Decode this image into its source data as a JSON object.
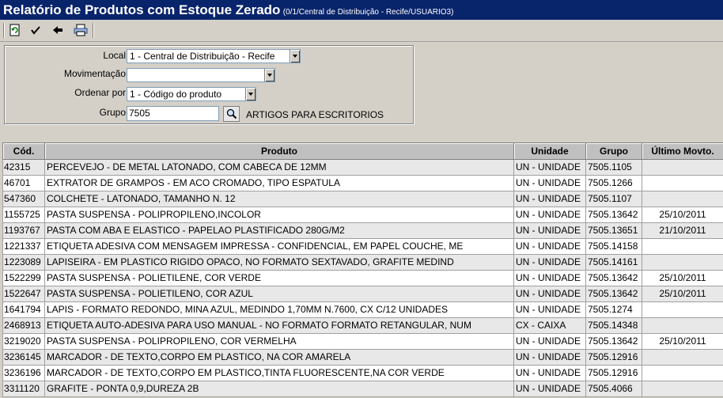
{
  "window": {
    "title": "Relatório de Produtos com Estoque Zerado",
    "subtitle": "(0/1/Central de Distribuição - Recife/USUARIO3)"
  },
  "toolbar": {
    "icons": [
      "refresh-icon",
      "check-icon",
      "back-arrow-icon",
      "printer-icon"
    ]
  },
  "filters": {
    "local_label": "Local",
    "local_value": "1 - Central de Distribuição - Recife",
    "movimentacao_label": "Movimentação",
    "movimentacao_value": "",
    "ordenar_label": "Ordenar por",
    "ordenar_value": "1 - Código do produto",
    "grupo_label": "Grupo",
    "grupo_value": "7505",
    "grupo_desc": "ARTIGOS PARA ESCRITORIOS"
  },
  "table": {
    "headers": [
      "Cód.",
      "Produto",
      "Unidade",
      "Grupo",
      "Último Movto."
    ],
    "rows": [
      [
        "42315",
        "PERCEVEJO - DE METAL LATONADO, COM CABECA DE 12MM",
        "UN - UNIDADE",
        "7505.1105",
        ""
      ],
      [
        "46701",
        "EXTRATOR DE GRAMPOS - EM ACO CROMADO, TIPO ESPATULA",
        "UN - UNIDADE",
        "7505.1266",
        ""
      ],
      [
        "547360",
        "COLCHETE - LATONADO, TAMANHO N. 12",
        "UN - UNIDADE",
        "7505.1107",
        ""
      ],
      [
        "1155725",
        "PASTA SUSPENSA - POLIPROPILENO,INCOLOR",
        "UN - UNIDADE",
        "7505.13642",
        "25/10/2011"
      ],
      [
        "1193767",
        "PASTA COM ABA E ELASTICO - PAPELAO PLASTIFICADO 280G/M2",
        "UN - UNIDADE",
        "7505.13651",
        "21/10/2011"
      ],
      [
        "1221337",
        "ETIQUETA ADESIVA COM MENSAGEM IMPRESSA - CONFIDENCIAL, EM PAPEL COUCHE, ME",
        "UN - UNIDADE",
        "7505.14158",
        ""
      ],
      [
        "1223089",
        "LAPISEIRA - EM PLASTICO RIGIDO OPACO, NO FORMATO SEXTAVADO, GRAFITE MEDIND",
        "UN - UNIDADE",
        "7505.14161",
        ""
      ],
      [
        "1522299",
        "PASTA SUSPENSA - POLIETILENE, COR VERDE",
        "UN - UNIDADE",
        "7505.13642",
        "25/10/2011"
      ],
      [
        "1522647",
        "PASTA SUSPENSA - POLIETILENO, COR AZUL",
        "UN - UNIDADE",
        "7505.13642",
        "25/10/2011"
      ],
      [
        "1641794",
        "LAPIS - FORMATO REDONDO, MINA AZUL, MEDINDO 1,70MM N.7600, CX C/12 UNIDADES",
        "UN - UNIDADE",
        "7505.1274",
        ""
      ],
      [
        "2468913",
        "ETIQUETA AUTO-ADESIVA PARA USO MANUAL - NO FORMATO FORMATO RETANGULAR, NUM",
        "CX - CAIXA",
        "7505.14348",
        ""
      ],
      [
        "3219020",
        "PASTA SUSPENSA - POLIPROPILENO, COR VERMELHA",
        "UN - UNIDADE",
        "7505.13642",
        "25/10/2011"
      ],
      [
        "3236145",
        "MARCADOR - DE TEXTO,CORPO EM PLASTICO, NA COR AMARELA",
        "UN - UNIDADE",
        "7505.12916",
        ""
      ],
      [
        "3236196",
        "MARCADOR - DE TEXTO,CORPO EM PLASTICO,TINTA FLUORESCENTE,NA COR VERDE",
        "UN - UNIDADE",
        "7505.12916",
        ""
      ],
      [
        "3311120",
        "GRAFITE - PONTA 0,9,DUREZA 2B",
        "UN - UNIDADE",
        "7505.4066",
        ""
      ]
    ]
  },
  "colors": {
    "titlebar": "#08246b",
    "window_bg": "#d4d0c8",
    "row_alt": "#e8e8e8"
  }
}
